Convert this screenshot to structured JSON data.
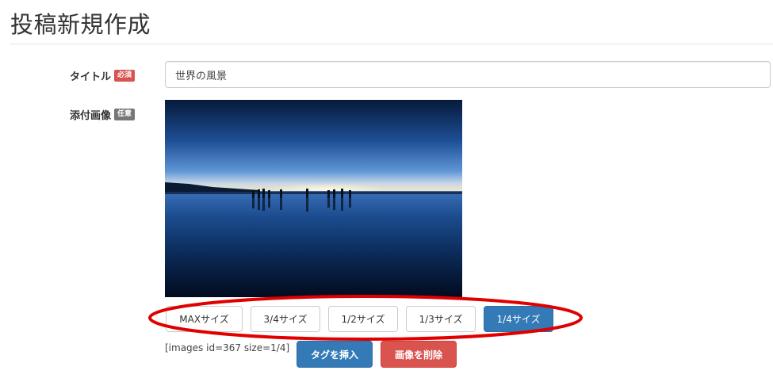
{
  "page": {
    "title": "投稿新規作成"
  },
  "form": {
    "title_field": {
      "label": "タイトル",
      "badge": "必須",
      "value": "世界の風景"
    },
    "image_field": {
      "label": "添付画像",
      "badge": "任意"
    },
    "size_buttons": [
      {
        "label": "MAXサイズ",
        "active": false
      },
      {
        "label": "3/4サイズ",
        "active": false
      },
      {
        "label": "1/2サイズ",
        "active": false
      },
      {
        "label": "1/3サイズ",
        "active": false
      },
      {
        "label": "1/4サイズ",
        "active": true
      }
    ],
    "shortcode": "[images id=367 size=1/4]",
    "insert_tag_button": "タグを挿入",
    "delete_image_button": "画像を削除"
  },
  "colors": {
    "primary": "#337ab7",
    "danger": "#d9534f",
    "badge_optional": "#777777",
    "annotation": "#e00000"
  }
}
